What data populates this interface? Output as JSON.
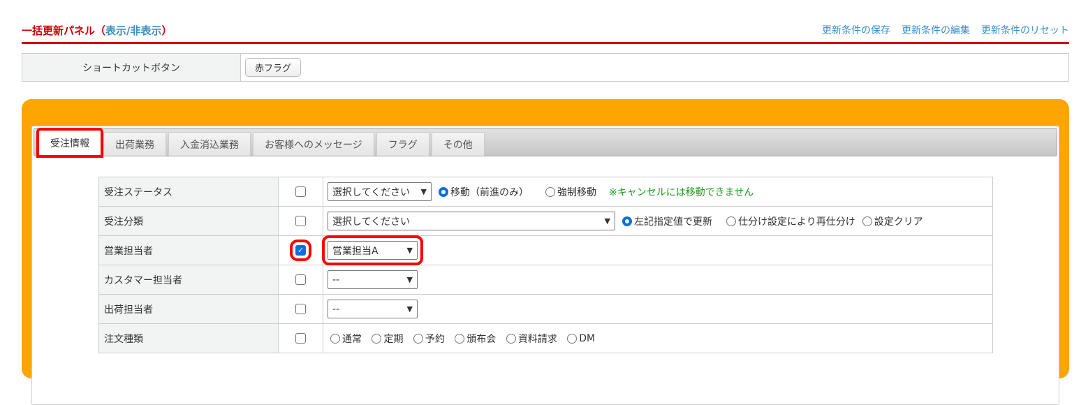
{
  "header": {
    "title": "一括更新パネル（",
    "toggle": "表示/非表示",
    "title_end": "）",
    "links": [
      "更新条件の保存",
      "更新条件の編集",
      "更新条件のリセット"
    ]
  },
  "shortcut": {
    "label": "ショートカットボタン",
    "button": "赤フラグ"
  },
  "tabs": [
    "受注情報",
    "出荷業務",
    "入金消込業務",
    "お客様へのメッセージ",
    "フラグ",
    "その他"
  ],
  "rows": {
    "status": {
      "label": "受注ステータス",
      "select": "選択してください",
      "radios": [
        "移動（前進のみ）",
        "強制移動"
      ],
      "note": "※キャンセルには移動できません"
    },
    "category": {
      "label": "受注分類",
      "select": "選択してください",
      "radios": [
        "左記指定値で更新",
        "仕分け設定により再仕分け",
        "設定クリア"
      ]
    },
    "sales": {
      "label": "営業担当者",
      "select": "営業担当A"
    },
    "customer": {
      "label": "カスタマー担当者",
      "select": "--"
    },
    "shipping": {
      "label": "出荷担当者",
      "select": "--"
    },
    "ordertype": {
      "label": "注文種類",
      "radios": [
        "通常",
        "定期",
        "予約",
        "頒布会",
        "資料請求",
        "DM"
      ]
    }
  }
}
